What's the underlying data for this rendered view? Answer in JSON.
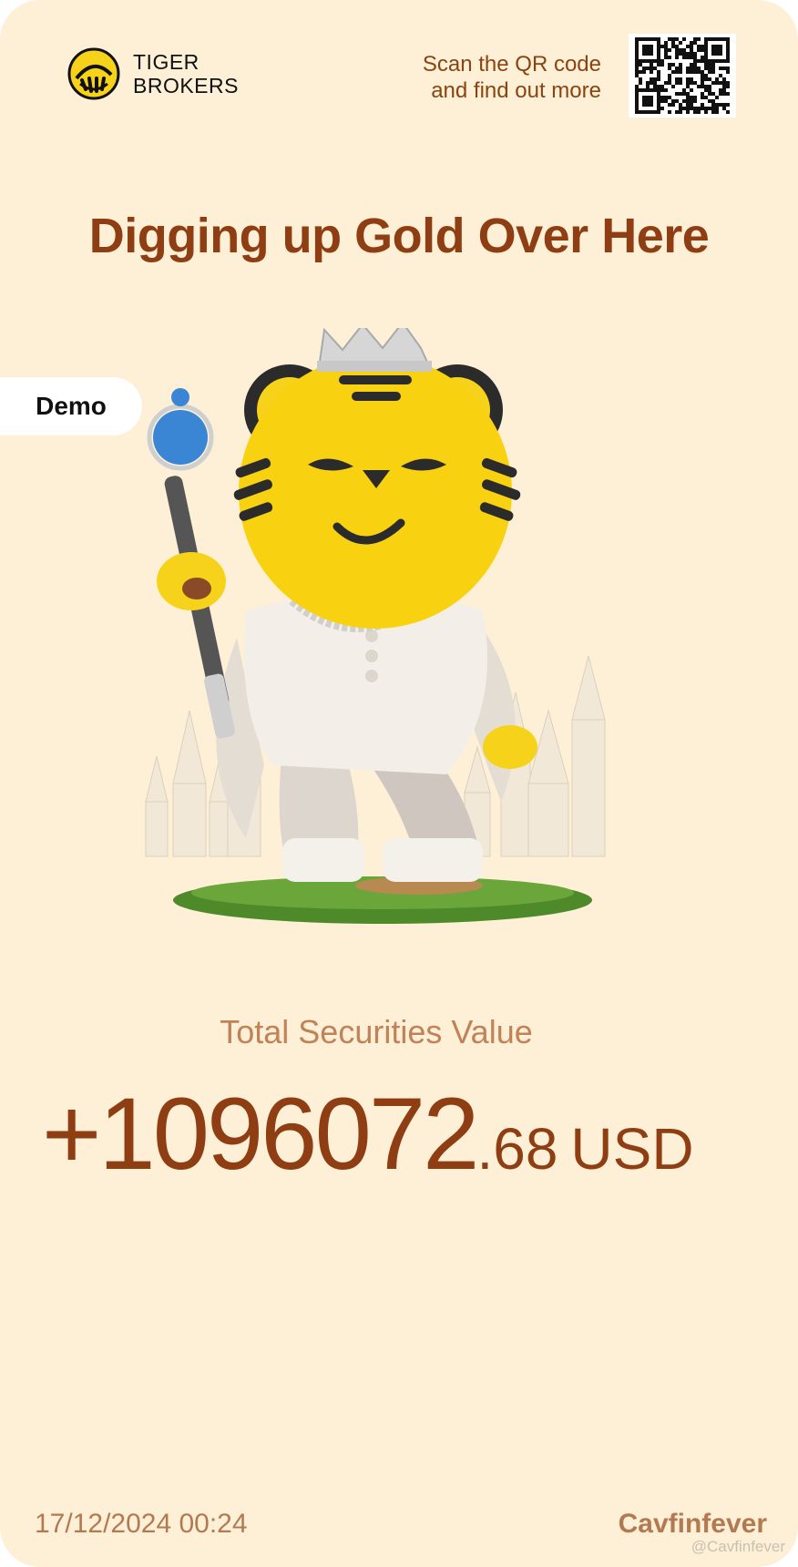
{
  "brand": {
    "line1": "TIGER",
    "line2": "BROKERS",
    "logo_icon": "tiger-logo-icon"
  },
  "qr": {
    "line1": "Scan the QR code",
    "line2": "and find out more",
    "icon": "qr-code-icon"
  },
  "headline": "Digging up Gold Over Here",
  "badge": "Demo",
  "hero_icon": "tiger-king-mascot-icon",
  "summary": {
    "label": "Total Securities Value",
    "integer": "+1096072",
    "decimal": ".68",
    "currency": "USD"
  },
  "footer": {
    "timestamp": "17/12/2024 00:24",
    "username": "Cavfinfever",
    "watermark": "@Cavfinfever"
  },
  "colors": {
    "background": "#fdf0d6",
    "accent": "#8f3d12",
    "muted": "#b37a52",
    "mascot_yellow": "#f8d210"
  }
}
